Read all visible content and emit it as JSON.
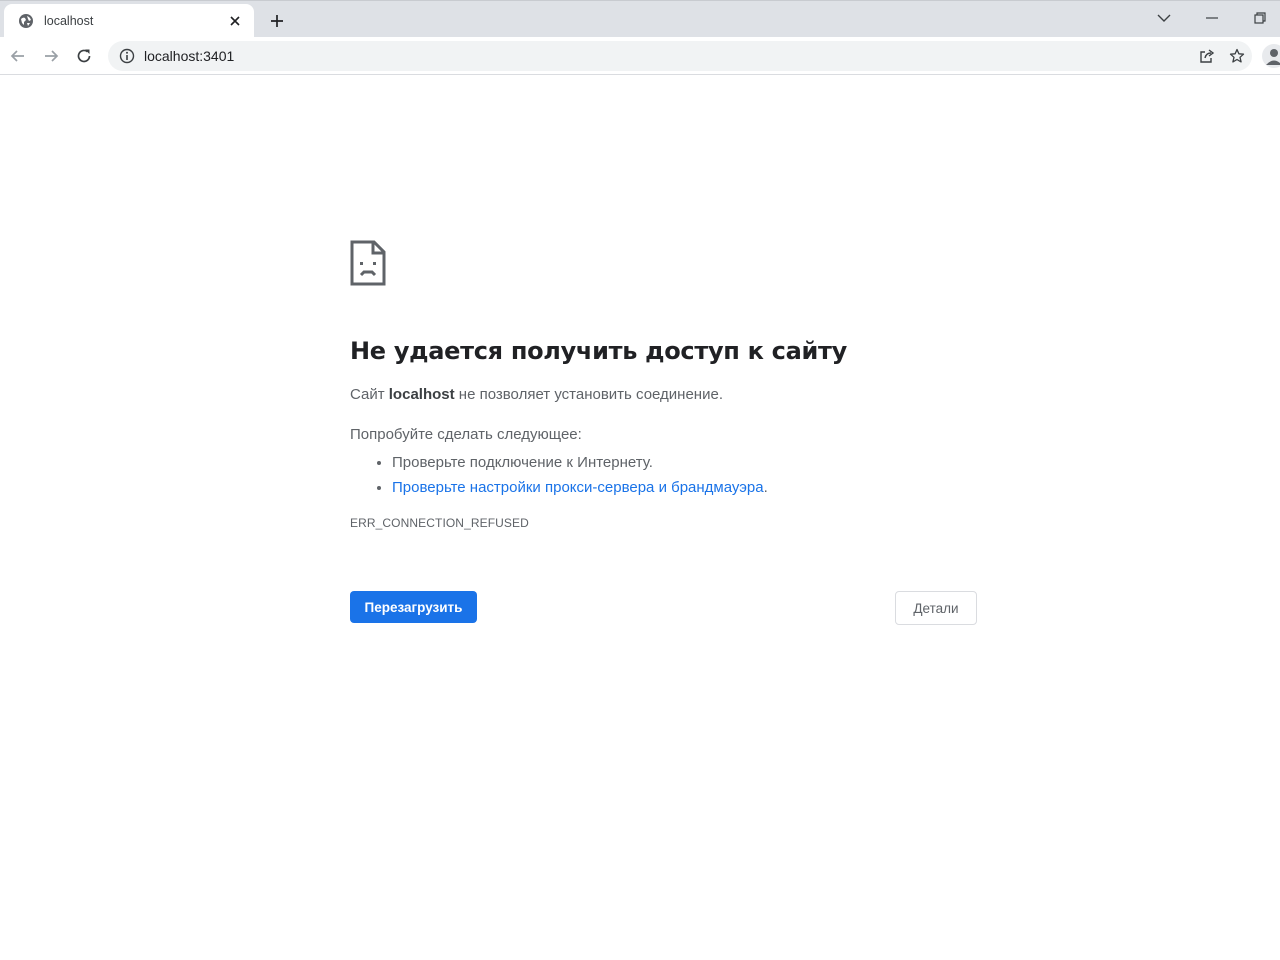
{
  "browser": {
    "tab": {
      "title": "localhost",
      "favicon": "globe-icon"
    },
    "address_bar": {
      "url": "localhost:3401"
    },
    "icons": {
      "tab_close": "close-icon",
      "new_tab": "plus-icon",
      "tab_search": "chevron-down-icon",
      "minimize": "minimize-icon",
      "restore": "restore-icon",
      "back": "arrow-left-icon",
      "forward": "arrow-right-icon",
      "reload": "reload-icon",
      "site_info": "info-icon",
      "share": "share-icon",
      "bookmark": "star-icon",
      "profile": "person-icon"
    }
  },
  "error_page": {
    "icon": "sad-document-icon",
    "heading": "Не удается получить доступ к сайту",
    "summary": {
      "prefix": "Сайт ",
      "host": "localhost",
      "suffix": " не позволяет установить соединение."
    },
    "suggestions_title": "Попробуйте сделать следующее:",
    "suggestions": [
      {
        "text": "Проверьте подключение к Интернету."
      },
      {
        "link": "Проверьте настройки прокси-сервера и брандмауэра",
        "tail": "."
      }
    ],
    "error_code": "ERR_CONNECTION_REFUSED",
    "buttons": {
      "reload": "Перезагрузить",
      "details": "Детали"
    }
  },
  "colors": {
    "accent": "#1a73e8",
    "text_primary": "#202124",
    "text_secondary": "#5f6368",
    "tabstrip_bg": "#dee1e6"
  }
}
